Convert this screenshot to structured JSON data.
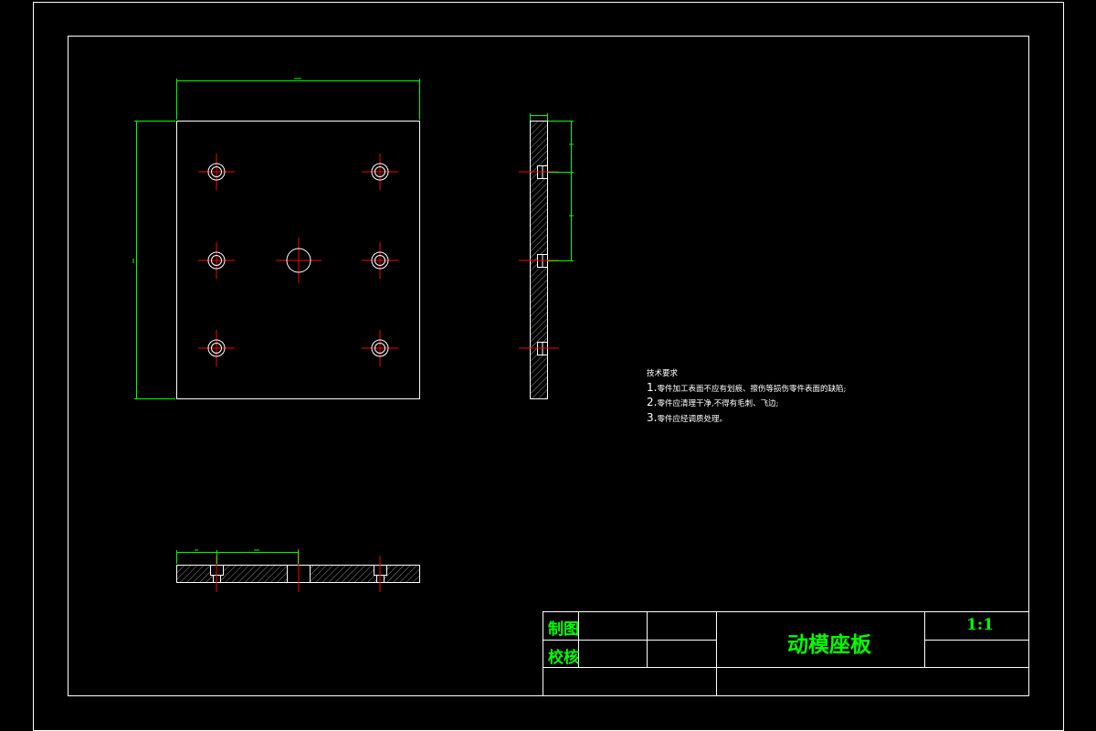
{
  "drawing": {
    "line_color": "#ffffff",
    "dimension_color": "#00ff00",
    "centerline_color": "#ff0000"
  },
  "technical_requirements": {
    "heading": "技术要求",
    "items": [
      {
        "num": "1.",
        "text": "零件加工表面不应有划痕、擦伤等损伤零件表面的缺陷;"
      },
      {
        "num": "2.",
        "text": "零件应清理干净,不得有毛刺、飞边;"
      },
      {
        "num": "3.",
        "text": "零件应经调质处理。"
      }
    ]
  },
  "title_block": {
    "drawn_label": "制图",
    "checked_label": "校核",
    "part_name": "动模座板",
    "scale": "1:1"
  }
}
